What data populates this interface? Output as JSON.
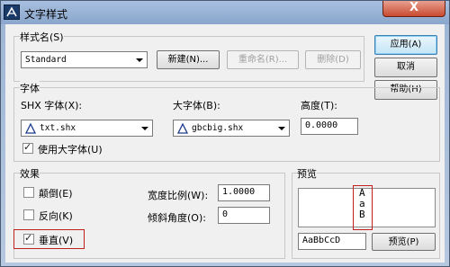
{
  "window": {
    "title": "文字样式",
    "close_symbol": "X"
  },
  "style_group": {
    "label": "样式名(S)",
    "selected_style": "Standard",
    "new_button": "新建(N)...",
    "rename_button": "重命名(R)...",
    "delete_button": "删除(D)"
  },
  "side_buttons": {
    "apply": "应用(A)",
    "cancel": "取消",
    "help": "帮助(H)"
  },
  "font_group": {
    "label": "字体",
    "shx_font_label": "SHX 字体(X):",
    "shx_font_value": "txt.shx",
    "big_font_label": "大字体(B):",
    "big_font_value": "gbcbig.shx",
    "height_label": "高度(T):",
    "height_value": "0.0000",
    "use_big_font_label": "使用大字体(U)",
    "use_big_font_checked": true
  },
  "effects_group": {
    "label": "效果",
    "upside_down_label": "颠倒(E)",
    "upside_down_checked": false,
    "backwards_label": "反向(K)",
    "backwards_checked": false,
    "vertical_label": "垂直(V)",
    "vertical_checked": true,
    "width_factor_label": "宽度比例(W):",
    "width_factor_value": "1.0000",
    "oblique_angle_label": "倾斜角度(O):",
    "oblique_angle_value": "0"
  },
  "preview_group": {
    "label": "预览",
    "preview_chars": [
      "A",
      "a",
      "B"
    ],
    "sample_text": "AaBbCcD",
    "preview_button": "预览(P)"
  },
  "colors": {
    "highlight": "#c02020",
    "title_bar": "#a8c0e0",
    "close_button": "#c84a30"
  }
}
